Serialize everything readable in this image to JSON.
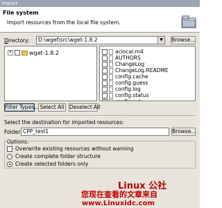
{
  "window": {
    "title": "Import"
  },
  "header": {
    "title": "File system",
    "description": "Import resources from the local file system.",
    "icon": "folder-icon"
  },
  "directory": {
    "label_prefix": "",
    "label_mnemonic": "D",
    "label_rest": "irectory:",
    "value": "D:\\wget\\src\\wget-1.8.2",
    "browse_label": "Browse..."
  },
  "tree": {
    "expander": "+",
    "item_label": "wget-1.8.2"
  },
  "files": [
    "aclocal.m4",
    "AUTHORS",
    "ChangeLog",
    "ChangeLog.README",
    "config.cache",
    "config.guess",
    "config.log",
    "config.status",
    "config.sub"
  ],
  "buttons": {
    "filter_types": "Filter Types...",
    "select_all": "Select All",
    "deselect_all": "Deselect All"
  },
  "destination": {
    "instruction": "Select the destination for imported resources:",
    "folder_label": "Folder:",
    "folder_value": "CPP_test1",
    "browse_label": "Browse..."
  },
  "options": {
    "title": "Options:",
    "overwrite": "Overwrite existing resources without warning",
    "complete_structure": "Create complete folder structure",
    "selected_only": "Create selected folders only",
    "selected": "selected_only"
  },
  "watermark": {
    "line1": "Linux 公社",
    "line2": "您现在查看的文章来自",
    "line3": "www.Linuxidc.com"
  },
  "colors": {
    "titlebar": "#9aa4b4",
    "dialog_bg": "#e8e4dc",
    "watermark": "#c00000"
  }
}
